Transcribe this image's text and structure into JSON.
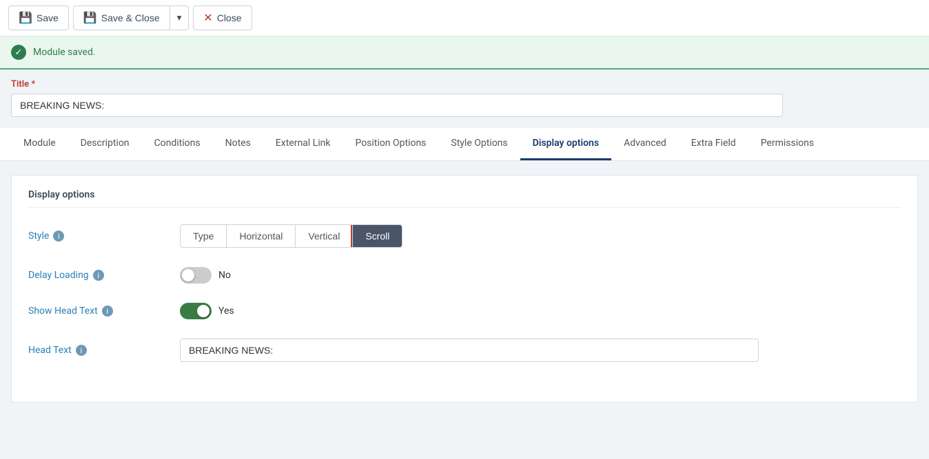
{
  "toolbar": {
    "save_label": "Save",
    "save_close_label": "Save & Close",
    "dropdown_label": "▾",
    "close_label": "Close"
  },
  "banner": {
    "message": "Module saved."
  },
  "title_section": {
    "label": "Title",
    "required": "*",
    "value": "BREAKING NEWS:"
  },
  "tabs": [
    {
      "id": "module",
      "label": "Module",
      "active": false
    },
    {
      "id": "description",
      "label": "Description",
      "active": false
    },
    {
      "id": "conditions",
      "label": "Conditions",
      "active": false
    },
    {
      "id": "notes",
      "label": "Notes",
      "active": false
    },
    {
      "id": "external-link",
      "label": "External Link",
      "active": false
    },
    {
      "id": "position-options",
      "label": "Position Options",
      "active": false
    },
    {
      "id": "style-options",
      "label": "Style Options",
      "active": false
    },
    {
      "id": "display-options",
      "label": "Display options",
      "active": true
    },
    {
      "id": "advanced",
      "label": "Advanced",
      "active": false
    },
    {
      "id": "extra-field",
      "label": "Extra Field",
      "active": false
    },
    {
      "id": "permissions",
      "label": "Permissions",
      "active": false
    }
  ],
  "display_options": {
    "card_title": "Display options",
    "style": {
      "label": "Style",
      "buttons": [
        {
          "id": "type",
          "label": "Type",
          "active": false
        },
        {
          "id": "horizontal",
          "label": "Horizontal",
          "active": false
        },
        {
          "id": "vertical",
          "label": "Vertical",
          "active": false
        },
        {
          "id": "scroll",
          "label": "Scroll",
          "active": true
        }
      ]
    },
    "delay_loading": {
      "label": "Delay Loading",
      "state": false,
      "state_label": "No"
    },
    "show_head_text": {
      "label": "Show Head Text",
      "state": true,
      "state_label": "Yes"
    },
    "head_text": {
      "label": "Head Text",
      "value": "BREAKING NEWS:"
    }
  },
  "icons": {
    "save": "💾",
    "check": "✓",
    "close_x": "✕",
    "info": "i",
    "check_circle": "✓"
  }
}
